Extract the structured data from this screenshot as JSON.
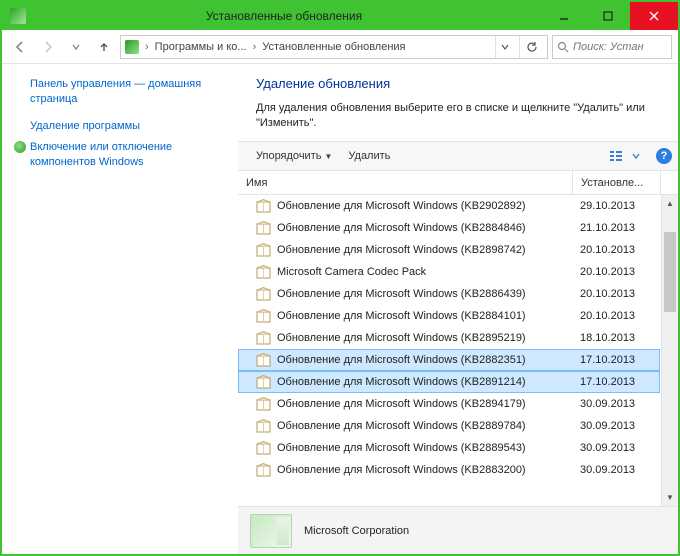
{
  "window": {
    "title": "Установленные обновления"
  },
  "nav": {
    "breadcrumb": [
      "Программы и ко...",
      "Установленные обновления"
    ],
    "search_placeholder": "Поиск: Устан"
  },
  "sidebar": {
    "links": [
      {
        "label": "Панель управления — домашняя страница",
        "icon": false
      },
      {
        "label": "Удаление программы",
        "icon": false
      },
      {
        "label": "Включение или отключение компонентов Windows",
        "icon": true
      }
    ]
  },
  "header": {
    "title": "Удаление обновления",
    "desc": "Для удаления обновления выберите его в списке и щелкните \"Удалить\" или \"Изменить\"."
  },
  "toolbar": {
    "organize": "Упорядочить",
    "uninstall": "Удалить"
  },
  "columns": {
    "name": "Имя",
    "installed": "Установле..."
  },
  "rows": [
    {
      "name": "Обновление для Microsoft Windows (KB2902892)",
      "date": "29.10.2013",
      "selected": false
    },
    {
      "name": "Обновление для Microsoft Windows (KB2884846)",
      "date": "21.10.2013",
      "selected": false
    },
    {
      "name": "Обновление для Microsoft Windows (KB2898742)",
      "date": "20.10.2013",
      "selected": false
    },
    {
      "name": "Microsoft Camera Codec Pack",
      "date": "20.10.2013",
      "selected": false
    },
    {
      "name": "Обновление для Microsoft Windows (KB2886439)",
      "date": "20.10.2013",
      "selected": false
    },
    {
      "name": "Обновление для Microsoft Windows (KB2884101)",
      "date": "20.10.2013",
      "selected": false
    },
    {
      "name": "Обновление для Microsoft Windows (KB2895219)",
      "date": "18.10.2013",
      "selected": false
    },
    {
      "name": "Обновление для Microsoft Windows (KB2882351)",
      "date": "17.10.2013",
      "selected": true
    },
    {
      "name": "Обновление для Microsoft Windows (KB2891214)",
      "date": "17.10.2013",
      "selected": true
    },
    {
      "name": "Обновление для Microsoft Windows (KB2894179)",
      "date": "30.09.2013",
      "selected": false
    },
    {
      "name": "Обновление для Microsoft Windows (KB2889784)",
      "date": "30.09.2013",
      "selected": false
    },
    {
      "name": "Обновление для Microsoft Windows (KB2889543)",
      "date": "30.09.2013",
      "selected": false
    },
    {
      "name": "Обновление для Microsoft Windows (KB2883200)",
      "date": "30.09.2013",
      "selected": false
    }
  ],
  "status": {
    "publisher": "Microsoft Corporation"
  }
}
